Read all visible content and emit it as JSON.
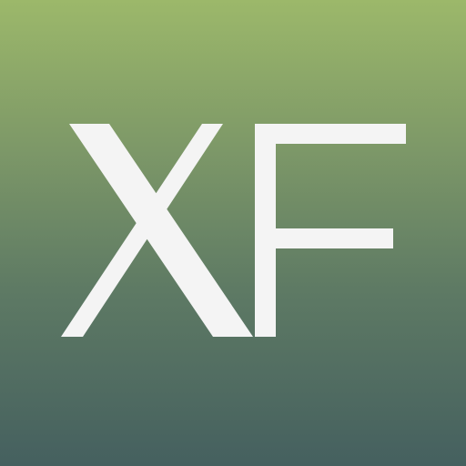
{
  "logo": {
    "text": "XF",
    "letters": [
      "X",
      "F"
    ],
    "letter_color": "#f4f4f4",
    "background_gradient": [
      "#9cb86a",
      "#7f9a68",
      "#5e7a64",
      "#45605f"
    ]
  }
}
